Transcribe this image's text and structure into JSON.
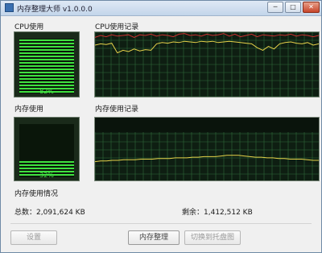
{
  "window": {
    "title": "内存整理大师 v1.0.0.0"
  },
  "titlebar_buttons": [
    "─",
    "□",
    "✕"
  ],
  "cpu": {
    "label": "CPU使用",
    "percent_text": "82%",
    "percent": 82
  },
  "cpu_history": {
    "label": "CPU使用记录"
  },
  "memory": {
    "label": "内存使用",
    "percent_text": "32%",
    "percent": 32
  },
  "memory_history": {
    "label": "内存使用记录"
  },
  "usage": {
    "label": "内存使用情况",
    "total": "总数：2,091,624 KB",
    "free": "剩余：1,412,512 KB"
  },
  "buttons": {
    "settings": "设置",
    "cleanup": "内存整理",
    "extra": "切换到托盘图"
  },
  "colors": {
    "graph_line": "#e6d24a",
    "cpu_peak": "#cc3030",
    "gauge_green": "#3fe13f",
    "grid": "#2f6b3a"
  },
  "chart_data": [
    {
      "type": "line",
      "title": "CPU使用记录",
      "ylim": [
        0,
        100
      ],
      "grid": true,
      "series": [
        {
          "values": [
            80,
            82,
            81,
            83,
            68,
            72,
            70,
            74,
            71,
            73,
            72,
            82,
            84,
            83,
            85,
            84,
            86,
            85,
            84,
            86,
            85,
            86,
            84,
            85,
            86,
            85,
            84,
            83,
            82,
            76,
            72,
            78,
            74,
            82,
            84,
            85,
            83,
            82,
            84,
            80,
            82
          ]
        },
        {
          "values": [
            92,
            95,
            93,
            96,
            94,
            95,
            96,
            92,
            96,
            95,
            97,
            94,
            96,
            95,
            93,
            97,
            98,
            95,
            96,
            94,
            97,
            95,
            96,
            98,
            94,
            97,
            93,
            95,
            97,
            93,
            96,
            95,
            94,
            96,
            95,
            97,
            94,
            96,
            95,
            93,
            95
          ]
        }
      ]
    },
    {
      "type": "line",
      "title": "内存使用记录",
      "ylim": [
        0,
        100
      ],
      "grid": true,
      "series": [
        {
          "values": [
            30,
            31,
            31,
            32,
            32,
            33,
            33,
            33,
            34,
            34,
            34,
            35,
            35,
            35,
            36,
            36,
            36,
            37,
            37,
            38,
            38,
            38,
            39,
            40,
            40,
            40,
            39,
            38,
            37,
            37,
            36,
            36,
            35,
            35,
            34,
            34,
            34,
            33,
            32,
            32
          ]
        }
      ]
    }
  ]
}
